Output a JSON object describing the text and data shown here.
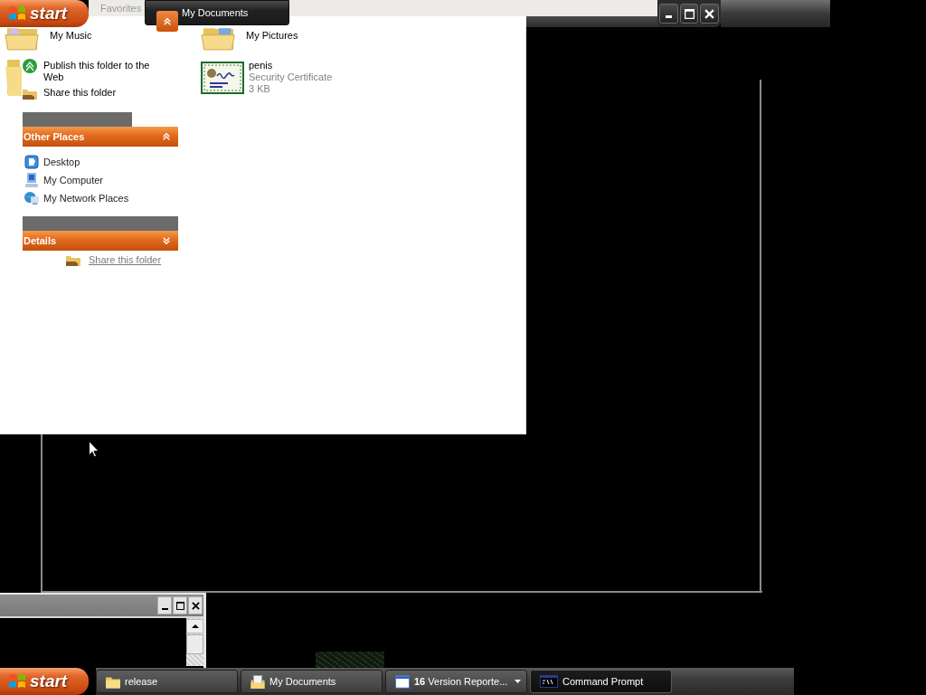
{
  "top_bar": {
    "start": "start",
    "menu": [
      "Favorites"
    ],
    "buttons": [
      {
        "label": "My Documents",
        "selected": false
      }
    ]
  },
  "explorer": {
    "folders": [
      {
        "name": "My Music",
        "kind": "music"
      },
      {
        "name": "My Pictures",
        "kind": "pictures"
      }
    ],
    "tasks": [
      {
        "label": "Publish this folder to the Web",
        "kind": "publish"
      },
      {
        "label": "Share this folder",
        "kind": "share"
      }
    ],
    "files": [
      {
        "name": "penis",
        "type": "Security Certificate",
        "size": "3 KB"
      }
    ],
    "panels": [
      {
        "title": "Other Places",
        "expanded": true,
        "items": [
          {
            "label": "Desktop",
            "kind": "desktop"
          },
          {
            "label": "My Computer",
            "kind": "computer"
          },
          {
            "label": "My Network Places",
            "kind": "network"
          }
        ]
      },
      {
        "title": "Details",
        "expanded": false
      }
    ],
    "stray_link": "Share this folder"
  },
  "taskbar": {
    "start": "start",
    "buttons": [
      {
        "label": "release",
        "kind": "folder",
        "selected": false
      },
      {
        "label": "My Documents",
        "kind": "documents",
        "selected": false
      },
      {
        "count": "16",
        "label": "Version Reporte...",
        "kind": "group",
        "selected": false
      },
      {
        "label": "Command Prompt",
        "kind": "console",
        "selected": true
      }
    ]
  }
}
